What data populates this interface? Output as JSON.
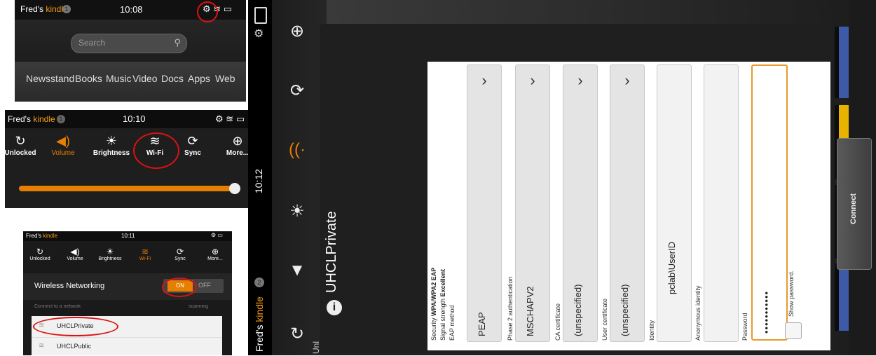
{
  "panel1": {
    "owner": "Fred's",
    "device": "kindle",
    "notifications": "1",
    "time": "10:08",
    "search": {
      "placeholder": "Search"
    },
    "nav": [
      "Newsstand",
      "Books",
      "Music",
      "Video",
      "Docs",
      "Apps",
      "Web"
    ]
  },
  "panel2": {
    "owner": "Fred's",
    "device": "kindle",
    "notifications": "1",
    "time": "10:10",
    "quick_settings": [
      {
        "label": "Unlocked",
        "icon": "rotate-icon"
      },
      {
        "label": "Volume",
        "icon": "volume-icon"
      },
      {
        "label": "Brightness",
        "icon": "brightness-icon"
      },
      {
        "label": "Wi-Fi",
        "icon": "wifi-icon"
      },
      {
        "label": "Sync",
        "icon": "sync-icon"
      },
      {
        "label": "More...",
        "icon": "plus-icon"
      }
    ],
    "brightness_level": 0.97,
    "accent": "#e67e00"
  },
  "panel3": {
    "owner": "Fred's",
    "device": "kindle",
    "time": "10:11",
    "quick_settings": [
      "Unlocked",
      "Volume",
      "Brightness",
      "Wi-Fi",
      "Sync",
      "More..."
    ],
    "wireless_label": "Wireless Networking",
    "toggle_on": "ON",
    "toggle_off": "OFF",
    "connect_label": "Connect to a network",
    "scanning": "scanning",
    "networks": [
      "UHCLPrivate",
      "UHCLPublic"
    ]
  },
  "panel4": {
    "time": "10:12",
    "owner": "Fred's",
    "device": "kindle",
    "notifications": "2",
    "sidebar_partial": "Unl",
    "dialog": {
      "title": "UHCLPrivate",
      "security_label": "Security",
      "security_value": "WPA/WPA2 EAP",
      "signal_label": "Signal strength",
      "signal_value": "Excellent",
      "eap_label": "EAP method",
      "eap_value": "PEAP",
      "phase2_label": "Phase 2 authentication",
      "phase2_value": "MSCHAPV2",
      "ca_label": "CA certificate",
      "ca_value": "(unspecified)",
      "user_cert_label": "User certificate",
      "user_cert_value": "(unspecified)",
      "identity_label": "Identity",
      "identity_value": "pclab\\UserID",
      "anon_label": "Anonymous identity",
      "password_label": "Password",
      "password_value": "•••••••••••",
      "show_password": "Show password.",
      "connect": "Connect"
    }
  }
}
